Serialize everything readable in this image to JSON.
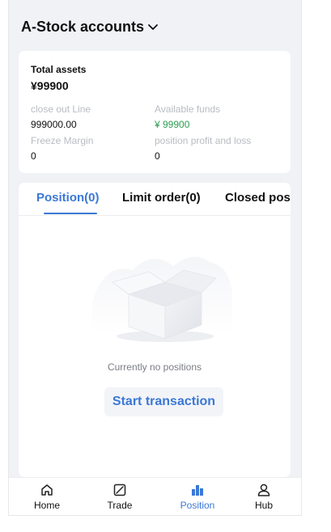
{
  "header": {
    "account_title": "A-Stock accounts"
  },
  "summary": {
    "total_assets_label": "Total assets",
    "total_assets_value": "¥99900",
    "close_out_line_label": "close out Line",
    "close_out_line_value": "999000.00",
    "available_funds_label": "Available funds",
    "available_funds_value": "¥ 99900",
    "freeze_margin_label": "Freeze Margin",
    "freeze_margin_value": "0",
    "position_pl_label": "position profit and loss",
    "position_pl_value": "0"
  },
  "tabs": [
    {
      "label": "Position(0)"
    },
    {
      "label": "Limit order(0)"
    },
    {
      "label": "Closed position"
    }
  ],
  "empty_state": {
    "message": "Currently no positions",
    "button_label": "Start transaction"
  },
  "bottom_nav": [
    {
      "label": "Home",
      "icon": "home-icon"
    },
    {
      "label": "Trade",
      "icon": "trade-icon"
    },
    {
      "label": "Position",
      "icon": "position-icon"
    },
    {
      "label": "Hub",
      "icon": "user-icon"
    }
  ],
  "colors": {
    "accent": "#3a78d6",
    "positive": "#2a9d4f",
    "background": "#f1f2f6"
  }
}
